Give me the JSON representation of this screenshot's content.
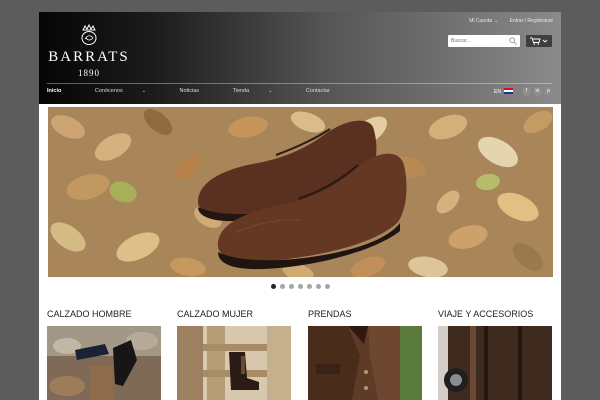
{
  "brand": {
    "name": "BARRATS",
    "year": "1890",
    "crest": "crown-crest-logo"
  },
  "toplinks": {
    "account": "Mi Cuenta",
    "login": "Entrar / Registrarse"
  },
  "search": {
    "placeholder": "Buscar..."
  },
  "cart": {
    "icon": "cart-icon"
  },
  "nav": [
    {
      "label": "Inicio",
      "active": true
    },
    {
      "label": "Conócenos",
      "dropdown": true
    },
    {
      "label": "Noticias"
    },
    {
      "label": "Tienda",
      "dropdown": true
    },
    {
      "label": "Contactar"
    }
  ],
  "lang": {
    "code": "EN"
  },
  "social": [
    "facebook",
    "linkedin",
    "pinterest"
  ],
  "social_letters": {
    "facebook": "f",
    "linkedin": "in",
    "pinterest": "p"
  },
  "slider": {
    "total": 7,
    "active": 1
  },
  "categories": [
    {
      "title": "CALZADO HOMBRE"
    },
    {
      "title": "CALZADO MUJER"
    },
    {
      "title": "PRENDAS"
    },
    {
      "title": "VIAJE Y ACCESORIOS"
    }
  ],
  "colors": {
    "background": "#5c5c5c",
    "header_dark": "#050505",
    "accent_dot": "#222222"
  }
}
